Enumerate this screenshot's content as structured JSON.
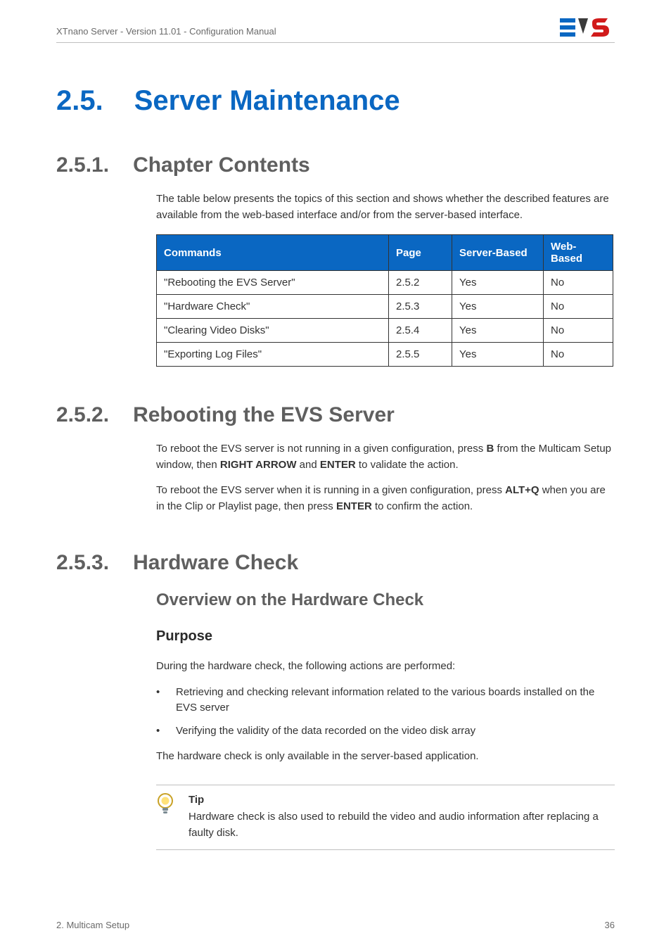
{
  "header": {
    "doc_title": "XTnano Server - Version 11.01 - Configuration Manual"
  },
  "section": {
    "num": "2.5.",
    "title": "Server Maintenance"
  },
  "s251": {
    "num": "2.5.1.",
    "title": "Chapter Contents",
    "intro": "The table below presents the topics of this section and shows whether the described features are available from the web-based interface and/or from the server-based interface.",
    "table": {
      "headers": {
        "c1": "Commands",
        "c2": "Page",
        "c3": "Server-Based",
        "c4": "Web-Based"
      },
      "rows": [
        {
          "c1": "\"Rebooting the EVS Server\"",
          "c2": "2.5.2",
          "c3": "Yes",
          "c4": "No"
        },
        {
          "c1": "\"Hardware Check\"",
          "c2": "2.5.3",
          "c3": "Yes",
          "c4": "No"
        },
        {
          "c1": "\"Clearing Video Disks\"",
          "c2": "2.5.4",
          "c3": "Yes",
          "c4": "No"
        },
        {
          "c1": "\"Exporting Log Files\"",
          "c2": "2.5.5",
          "c3": "Yes",
          "c4": "No"
        }
      ]
    }
  },
  "s252": {
    "num": "2.5.2.",
    "title": "Rebooting the EVS Server",
    "p1_a": "To reboot the EVS server is not running in a given configuration, press ",
    "p1_b": "B",
    "p1_c": " from the Multicam Setup window, then ",
    "p1_d": "RIGHT ARROW",
    "p1_e": " and ",
    "p1_f": "ENTER",
    "p1_g": " to validate the action.",
    "p2_a": "To reboot the EVS server when it is running in a given configuration, press ",
    "p2_b": "ALT+Q",
    "p2_c": " when you are in the Clip or Playlist page, then press ",
    "p2_d": "ENTER",
    "p2_e": " to confirm the action."
  },
  "s253": {
    "num": "2.5.3.",
    "title": "Hardware Check",
    "overview_title": "Overview on the Hardware Check",
    "purpose_title": "Purpose",
    "p1": "During the hardware check, the following actions are performed:",
    "li1": "Retrieving and checking relevant information related to the various boards installed on the EVS server",
    "li2": "Verifying the validity of the data recorded on the video disk array",
    "p2": "The hardware check is only available in the server-based application.",
    "tip_label": "Tip",
    "tip_text": "Hardware check is also used to rebuild the video and audio information after replacing a faulty disk."
  },
  "footer": {
    "left": "2. Multicam Setup",
    "right": "36"
  }
}
